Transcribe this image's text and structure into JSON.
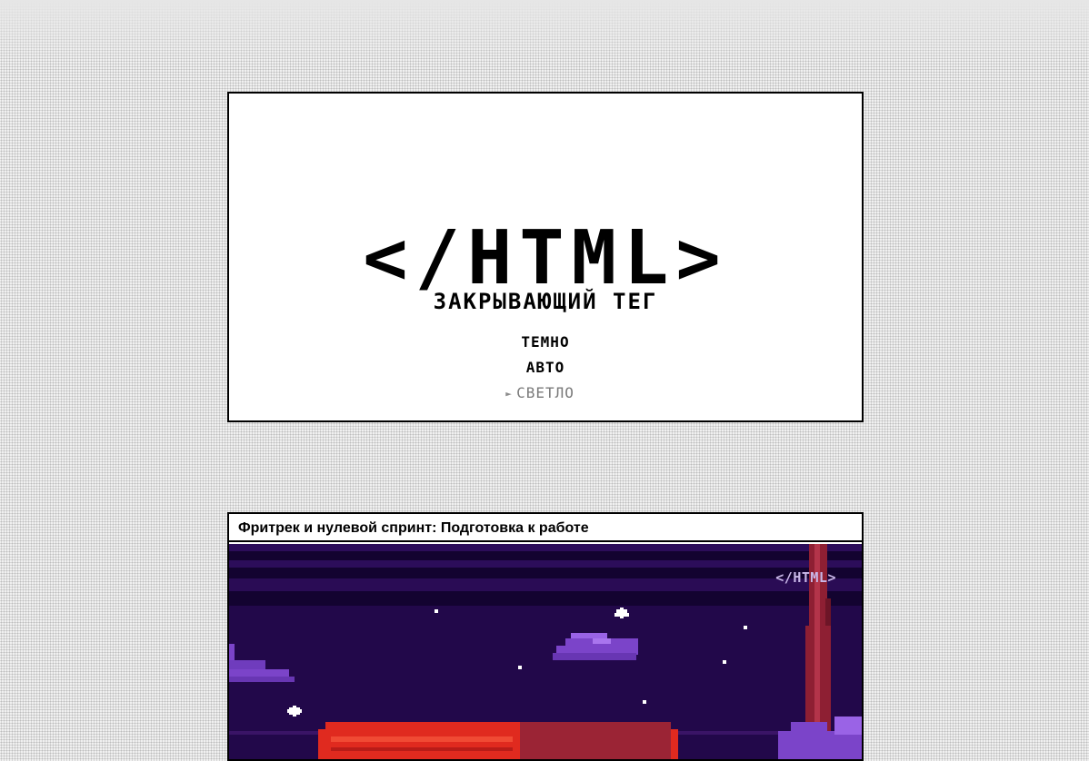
{
  "hero": {
    "logo": "</HTML>",
    "subtitle": "ЗАКРЫВАЮЩИЙ ТЕГ",
    "theme_options": [
      {
        "label": "ТЕМНО",
        "selected": false
      },
      {
        "label": "АВТО",
        "selected": false
      },
      {
        "label": "СВЕТЛО",
        "selected": true
      }
    ],
    "selected_marker": "►"
  },
  "article": {
    "title": "Фритрек и нулевой спринт: Подготовка к работе",
    "cover_logo": "</HTML>"
  },
  "colors": {
    "card_background": "#ffffff",
    "card_border": "#000000",
    "selected_option": "#7a7a7a",
    "cover_sky": "#22084a",
    "cover_band_dark": "#130330",
    "cover_cloud": "#7b44c9",
    "cover_red": "#e02a1f",
    "cover_pillar": "#8e1f33"
  }
}
